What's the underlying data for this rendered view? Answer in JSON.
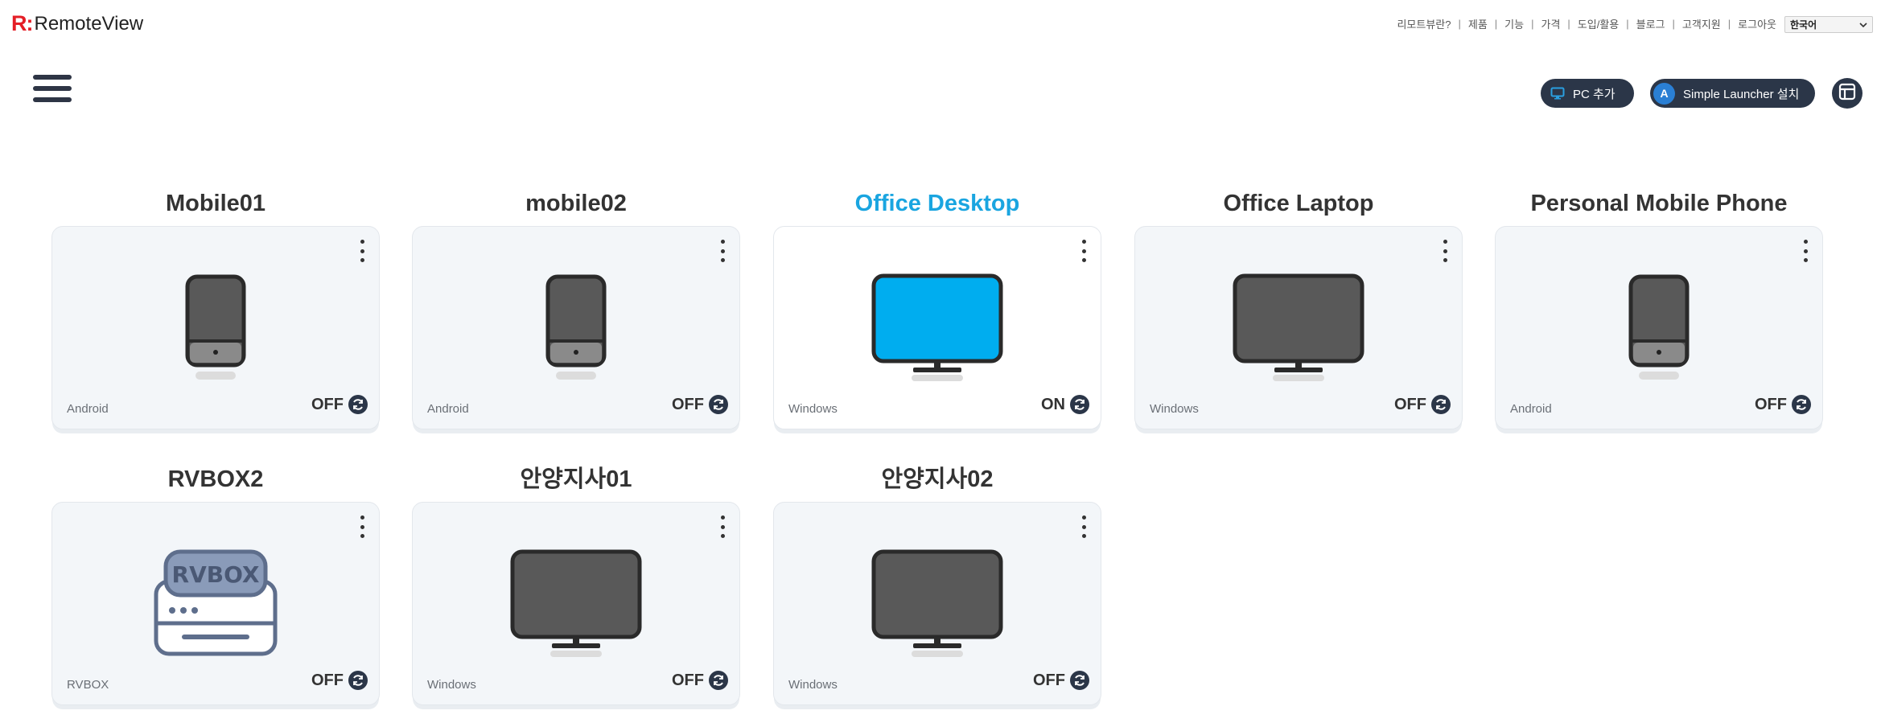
{
  "app": {
    "logo_mark": "R:",
    "logo_text": "RemoteView"
  },
  "topnav": {
    "links": [
      "리모트뷰란?",
      "제품",
      "기능",
      "가격",
      "도입/활용",
      "블로그",
      "고객지원",
      "로그아웃"
    ],
    "language": "한국어"
  },
  "toolbar": {
    "add_pc_label": "PC 추가",
    "simple_launcher_label": "Simple Launcher 설치",
    "simple_launcher_avatar": "A"
  },
  "devices": [
    {
      "name": "Mobile01",
      "os": "Android",
      "status": "OFF",
      "icon": "mobile-phone-icon"
    },
    {
      "name": "mobile02",
      "os": "Android",
      "status": "OFF",
      "icon": "mobile-phone-icon"
    },
    {
      "name": "Office Desktop",
      "os": "Windows",
      "status": "ON",
      "icon": "monitor-icon"
    },
    {
      "name": "Office Laptop",
      "os": "Windows",
      "status": "OFF",
      "icon": "monitor-icon"
    },
    {
      "name": "Personal Mobile Phone",
      "os": "Android",
      "status": "OFF",
      "icon": "mobile-phone-icon"
    },
    {
      "name": "RVBOX2",
      "os": "RVBOX",
      "status": "OFF",
      "icon": "rvbox-icon",
      "icon_text": "RVBOX"
    },
    {
      "name": "안양지사01",
      "os": "Windows",
      "status": "OFF",
      "icon": "monitor-icon"
    },
    {
      "name": "안양지사02",
      "os": "Windows",
      "status": "OFF",
      "icon": "monitor-icon"
    }
  ],
  "colors": {
    "active_title": "#1aa5e0",
    "monitor_on": "#00adef",
    "monitor_off": "#595959",
    "button_bg": "#2b3648",
    "logo_red": "#e41e26"
  }
}
